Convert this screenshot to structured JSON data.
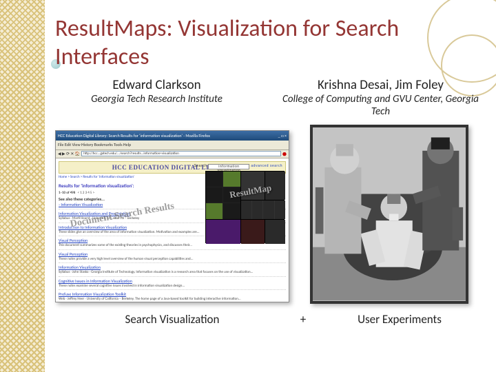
{
  "title": "ResultMaps:  Visualization for Search Interfaces",
  "authors": {
    "left": {
      "name": "Edward Clarkson",
      "affil": "Georgia Tech Research Institute"
    },
    "right": {
      "name": "Krishna Desai, Jim Foley",
      "affil": "College of Computing and GVU Center, Georgia Tech"
    }
  },
  "screenshot": {
    "window_title": "HCC Education Digital Library: Search Results for 'information visualization' - Mozilla Firefox",
    "address": "http://hcc...gatech.edu/.../search?results...information+visualization",
    "banner": "HCC EDUCATION DIGITAL LIBRARY",
    "search_label": "Search",
    "search_value": "information visualization",
    "adv_search": "advanced search",
    "breadcrumb": "Home > Search > Results for 'information visualization'",
    "results_hdr": "Results for 'information visualization':",
    "count_line": "1–10 of 498",
    "see_also": "See also these categories...",
    "see_also_link": "› Information Visualization",
    "r1_title": "Information Visualization and Presentation",
    "r1_text": "Syllabus · Marti Hearst · University of California – Berkeley",
    "r2_title": "Introduction to Information Visualization",
    "r2_text": "These slides give an overview of the area of information visualization. Motivation and examples are...",
    "r3_title": "Visual Perception",
    "r3_text": "This document summarizes some of the existing theories in psychophysics, and discusses their...",
    "r4_title": "Visual Perception",
    "r4_text": "These notes provide a very high level overview of the human visual perception capabilities and...",
    "r5_title": "Information Visualization",
    "r5_text": "Syllabus · John Stasko · Georgia Institute of Technology. Information visualization is a research area that focuses on the use of visualization...",
    "r6_title": "Cognitive Issues in Information Visualization",
    "r6_text": "These notes examine several cognitive issues involved in information visualization design...",
    "r7_title": "Prefuse Information Visualization Toolkit",
    "r7_text": "Web · Jeffrey Heer · University of California – Berkeley. The home page of a Java-based toolkit for building interactive information...",
    "overlay_left": "Document Search Results",
    "overlay_right": "ResultMap"
  },
  "captions": {
    "left": "Search Visualization",
    "plus": "+",
    "right": "User Experiments"
  }
}
